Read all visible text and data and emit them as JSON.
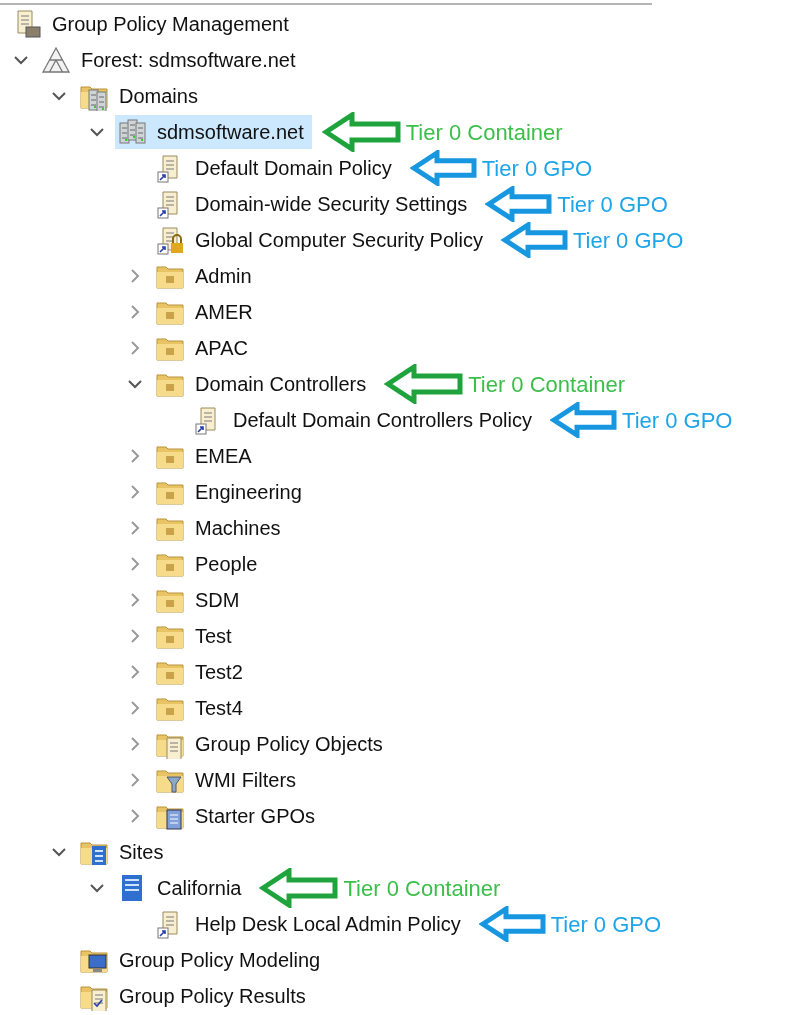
{
  "tree": [
    {
      "label": "Group Policy Management",
      "kind": "console",
      "selected": false,
      "children": [
        {
          "label": "Forest: sdmsoftware.net",
          "kind": "forest",
          "expanded": true,
          "selected": false,
          "children": [
            {
              "label": "Domains",
              "kind": "domains",
              "expanded": true,
              "selected": false,
              "children": [
                {
                  "label": "sdmsoftware.net",
                  "kind": "domain",
                  "expanded": true,
                  "selected": true,
                  "annotation": {
                    "kind": "container",
                    "text": "Tier 0 Container"
                  },
                  "children": [
                    {
                      "label": "Default Domain Policy",
                      "kind": "gpo",
                      "selected": false,
                      "annotation": {
                        "kind": "gpo",
                        "text": "Tier 0 GPO"
                      }
                    },
                    {
                      "label": "Domain-wide Security Settings",
                      "kind": "gpo",
                      "selected": false,
                      "annotation": {
                        "kind": "gpo",
                        "text": "Tier 0 GPO"
                      }
                    },
                    {
                      "label": "Global Computer Security Policy",
                      "kind": "gpo-locked",
                      "selected": false,
                      "annotation": {
                        "kind": "gpo",
                        "text": "Tier 0 GPO"
                      }
                    },
                    {
                      "label": "Admin",
                      "kind": "ou",
                      "expanded": false,
                      "selected": false
                    },
                    {
                      "label": "AMER",
                      "kind": "ou",
                      "expanded": false,
                      "selected": false
                    },
                    {
                      "label": "APAC",
                      "kind": "ou",
                      "expanded": false,
                      "selected": false
                    },
                    {
                      "label": "Domain Controllers",
                      "kind": "ou",
                      "expanded": true,
                      "selected": false,
                      "annotation": {
                        "kind": "container",
                        "text": "Tier 0 Container"
                      },
                      "children": [
                        {
                          "label": "Default Domain Controllers Policy",
                          "kind": "gpo",
                          "selected": false,
                          "annotation": {
                            "kind": "gpo",
                            "text": "Tier 0 GPO"
                          }
                        }
                      ]
                    },
                    {
                      "label": "EMEA",
                      "kind": "ou",
                      "expanded": false,
                      "selected": false
                    },
                    {
                      "label": "Engineering",
                      "kind": "ou",
                      "expanded": false,
                      "selected": false
                    },
                    {
                      "label": "Machines",
                      "kind": "ou",
                      "expanded": false,
                      "selected": false
                    },
                    {
                      "label": "People",
                      "kind": "ou",
                      "expanded": false,
                      "selected": false
                    },
                    {
                      "label": "SDM",
                      "kind": "ou",
                      "expanded": false,
                      "selected": false
                    },
                    {
                      "label": "Test",
                      "kind": "ou",
                      "expanded": false,
                      "selected": false
                    },
                    {
                      "label": "Test2",
                      "kind": "ou",
                      "expanded": false,
                      "selected": false
                    },
                    {
                      "label": "Test4",
                      "kind": "ou",
                      "expanded": false,
                      "selected": false
                    },
                    {
                      "label": "Group Policy Objects",
                      "kind": "gpo-folder",
                      "expanded": false,
                      "selected": false
                    },
                    {
                      "label": "WMI Filters",
                      "kind": "wmi-folder",
                      "expanded": false,
                      "selected": false
                    },
                    {
                      "label": "Starter GPOs",
                      "kind": "starter-folder",
                      "expanded": false,
                      "selected": false
                    }
                  ]
                }
              ]
            },
            {
              "label": "Sites",
              "kind": "sites",
              "expanded": true,
              "selected": false,
              "children": [
                {
                  "label": "California",
                  "kind": "site",
                  "expanded": true,
                  "selected": false,
                  "annotation": {
                    "kind": "container",
                    "text": "Tier 0 Container"
                  },
                  "children": [
                    {
                      "label": "Help Desk Local Admin Policy",
                      "kind": "gpo",
                      "selected": false,
                      "annotation": {
                        "kind": "gpo",
                        "text": "Tier 0 GPO"
                      }
                    }
                  ]
                }
              ]
            },
            {
              "label": "Group Policy Modeling",
              "kind": "modeling",
              "selected": false
            },
            {
              "label": "Group Policy Results",
              "kind": "results",
              "selected": false
            }
          ]
        }
      ]
    }
  ]
}
